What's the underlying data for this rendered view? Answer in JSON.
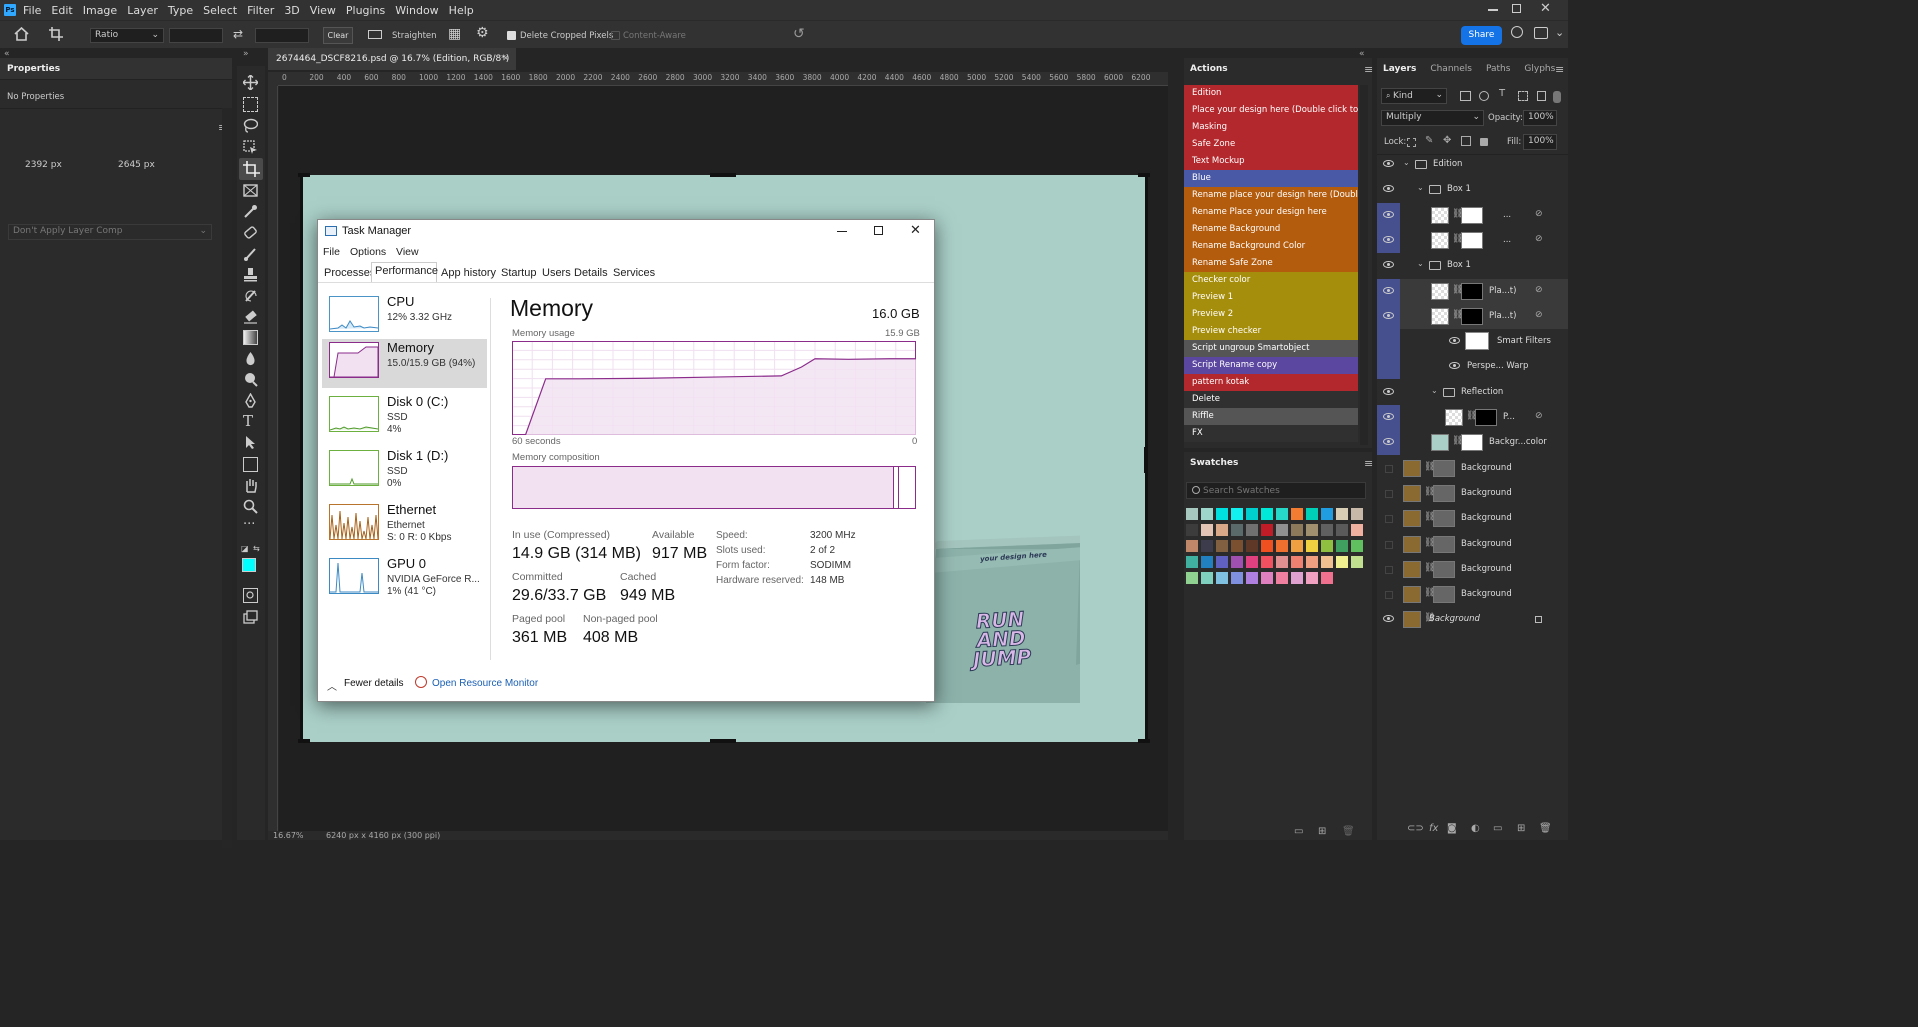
{
  "app": {
    "logo": "Ps"
  },
  "menu": [
    "File",
    "Edit",
    "Image",
    "Layer",
    "Type",
    "Select",
    "Filter",
    "3D",
    "View",
    "Plugins",
    "Window",
    "Help"
  ],
  "options": {
    "ratio_label": "Ratio",
    "clear": "Clear",
    "straighten": "Straighten",
    "delete_cropped": "Delete Cropped Pixels",
    "content_aware": "Content-Aware",
    "share": "Share"
  },
  "properties": {
    "title": "Properties",
    "empty": "No Properties",
    "width": "2392 px",
    "height": "2645 px",
    "layer_comp": "Don't Apply Layer Comp"
  },
  "document": {
    "tab": "2674464_DSCF8216.psd @ 16.7% (Edition, RGB/8*)",
    "status_zoom": "16.67%",
    "status_size": "6240 px x 4160 px (300 ppi)",
    "ruler": [
      "0",
      "200",
      "400",
      "600",
      "800",
      "1000",
      "1200",
      "1400",
      "1600",
      "1800",
      "2000",
      "2200",
      "2400",
      "2600",
      "2800",
      "3000",
      "3200",
      "3400",
      "3600",
      "3800",
      "4000",
      "4200",
      "4400",
      "4600",
      "4800",
      "5000",
      "5200",
      "5400",
      "5600",
      "5800",
      "6000",
      "6200"
    ]
  },
  "mockup": {
    "box_small": "your design here",
    "box_big": [
      "RUN",
      "AND",
      "JUMP"
    ]
  },
  "actions": {
    "title": "Actions",
    "items": [
      {
        "label": "Edition",
        "color": "#b3282d"
      },
      {
        "label": "Place your design here (Double click to...",
        "color": "#b3282d"
      },
      {
        "label": "Masking",
        "color": "#b3282d"
      },
      {
        "label": "Safe Zone",
        "color": "#b3282d"
      },
      {
        "label": "Text Mockup",
        "color": "#b3282d"
      },
      {
        "label": "Blue",
        "color": "#4a59a6"
      },
      {
        "label": "Rename place your design here (Doubl...",
        "color": "#b35c0e"
      },
      {
        "label": "Rename Place your design here",
        "color": "#b35c0e"
      },
      {
        "label": "Rename Background",
        "color": "#b35c0e"
      },
      {
        "label": "Rename Background Color",
        "color": "#b35c0e"
      },
      {
        "label": "Rename Safe Zone",
        "color": "#b35c0e"
      },
      {
        "label": "Checker color",
        "color": "#a68e0d"
      },
      {
        "label": "Preview 1",
        "color": "#a68e0d"
      },
      {
        "label": "Preview 2",
        "color": "#a68e0d"
      },
      {
        "label": "Preview checker",
        "color": "#a68e0d"
      },
      {
        "label": "Script ungroup Smartobject",
        "color": "#555555"
      },
      {
        "label": "Script Rename copy",
        "color": "#5b46a0"
      },
      {
        "label": "pattern kotak",
        "color": "#b3282d"
      },
      {
        "label": "Delete",
        "color": "#303030"
      },
      {
        "label": "Riffle",
        "color": "#555555"
      },
      {
        "label": "FX",
        "color": "#303030"
      }
    ]
  },
  "swatches": {
    "title": "Swatches",
    "search_placeholder": "Search Swatches",
    "colors": [
      "#a7c8bf",
      "#9fd6cb",
      "#00e0e0",
      "#12f0f0",
      "#00cfd0",
      "#00e8d8",
      "#27d8c8",
      "#f27d32",
      "#00d0b8",
      "#1f9de0",
      "#d8cdb5",
      "#c8b8a8",
      "#3c3c3c",
      "#e3c3b3",
      "#d8a888",
      "#5a6a6a",
      "#707070",
      "#c01c28",
      "#909090",
      "#8c7a5a",
      "#a09070",
      "#606060",
      "#5a5a5a",
      "#f0b0a0",
      "#c08868",
      "#3c3c4c",
      "#806040",
      "#7a5030",
      "#603828",
      "#f05020",
      "#f07030",
      "#f0a040",
      "#f0d040",
      "#90c040",
      "#40a060",
      "#60c060",
      "#40b0a0",
      "#2080c0",
      "#6060c0",
      "#a050b0",
      "#e04080",
      "#f05060",
      "#e09090",
      "#f08070",
      "#f0a080",
      "#f0c090",
      "#f0f090",
      "#c0e090",
      "#90d090",
      "#80d0c0",
      "#80c0e0",
      "#8090e0",
      "#b080e0",
      "#e080c0",
      "#f080a0",
      "#e0a0d0",
      "#f0a0c0",
      "#f07090"
    ]
  },
  "layers": {
    "tabs": [
      "Layers",
      "Channels",
      "Paths",
      "Glyphs"
    ],
    "kind": "Kind",
    "blend": "Multiply",
    "opacity_label": "Opacity:",
    "opacity": "100%",
    "lock_label": "Lock:",
    "fill_label": "Fill:",
    "fill": "100%",
    "rows": [
      {
        "name": "Edition",
        "type": "group",
        "indent": 0
      },
      {
        "name": "Box 1",
        "type": "group",
        "indent": 1
      },
      {
        "name": "...",
        "type": "layer",
        "indent": 2
      },
      {
        "name": "...",
        "type": "layer",
        "indent": 2
      },
      {
        "name": "Box 1",
        "type": "group",
        "indent": 1
      },
      {
        "name": "Pla...t)",
        "type": "layer",
        "indent": 2
      },
      {
        "name": "Pla...t)",
        "type": "layer",
        "indent": 2
      },
      {
        "name": "Smart Filters",
        "type": "filter",
        "indent": 3
      },
      {
        "name": "Perspe... Warp",
        "type": "filter",
        "indent": 3
      },
      {
        "name": "Reflection",
        "type": "group",
        "indent": 2
      },
      {
        "name": "P...",
        "type": "layer",
        "indent": 3
      },
      {
        "name": "Backgr...color",
        "type": "layer",
        "indent": 2
      },
      {
        "name": "Background",
        "type": "layer",
        "indent": 0
      },
      {
        "name": "Background",
        "type": "layer",
        "indent": 0
      },
      {
        "name": "Background",
        "type": "layer",
        "indent": 0
      },
      {
        "name": "Background",
        "type": "layer",
        "indent": 0
      },
      {
        "name": "Background",
        "type": "layer",
        "indent": 0
      },
      {
        "name": "Background",
        "type": "layer",
        "indent": 0
      },
      {
        "name": "Background",
        "type": "layer",
        "indent": 0
      }
    ]
  },
  "taskmanager": {
    "title": "Task Manager",
    "menu": [
      "File",
      "Options",
      "View"
    ],
    "tabs": [
      "Processes",
      "Performance",
      "App history",
      "Startup",
      "Users",
      "Details",
      "Services"
    ],
    "sidebar": [
      {
        "name": "CPU",
        "line1": "12%  3.32 GHz",
        "line2": "",
        "line3": ""
      },
      {
        "name": "Memory",
        "line1": "15.0/15.9 GB (94%)",
        "line2": "",
        "line3": ""
      },
      {
        "name": "Disk 0 (C:)",
        "line1": "SSD",
        "line2": "4%",
        "line3": ""
      },
      {
        "name": "Disk 1 (D:)",
        "line1": "SSD",
        "line2": "0%",
        "line3": ""
      },
      {
        "name": "Ethernet",
        "line1": "Ethernet",
        "line2": "S: 0  R: 0 Kbps",
        "line3": ""
      },
      {
        "name": "GPU 0",
        "line1": "NVIDIA GeForce R...",
        "line2": "1% (41 °C)",
        "line3": ""
      }
    ],
    "memory": {
      "heading": "Memory",
      "total": "16.0 GB",
      "usage_label": "Memory usage",
      "usage_max": "15.9 GB",
      "time_left": "60 seconds",
      "time_right": "0",
      "composition_label": "Memory composition",
      "in_use_label": "In use (Compressed)",
      "in_use": "14.9 GB (314 MB)",
      "available_label": "Available",
      "available": "917 MB",
      "committed_label": "Committed",
      "committed": "29.6/33.7 GB",
      "cached_label": "Cached",
      "cached": "949 MB",
      "paged_label": "Paged pool",
      "paged": "361 MB",
      "nonpaged_label": "Non-paged pool",
      "nonpaged": "408 MB",
      "speed_label": "Speed:",
      "speed": "3200 MHz",
      "slots_label": "Slots used:",
      "slots": "2 of 2",
      "form_label": "Form factor:",
      "form": "SODIMM",
      "hw_label": "Hardware reserved:",
      "hw": "148 MB"
    },
    "fewer_details": "Fewer details",
    "resource_monitor": "Open Resource Monitor"
  },
  "chart_data": {
    "type": "line",
    "xlabel": "",
    "ylabel": "",
    "x": [
      0,
      2,
      5,
      10,
      20,
      30,
      40,
      43,
      45,
      50,
      56,
      60
    ],
    "series": [
      {
        "values": [
          0,
          0,
          9.5,
          9.5,
          9.6,
          9.8,
          10.0,
          11.5,
          12.9,
          12.8,
          12.9,
          12.9
        ]
      }
    ],
    "ylim": [
      0,
      15.9
    ]
  },
  "colors": {
    "accent": "#8b2c8b",
    "share": "#1473e6"
  }
}
